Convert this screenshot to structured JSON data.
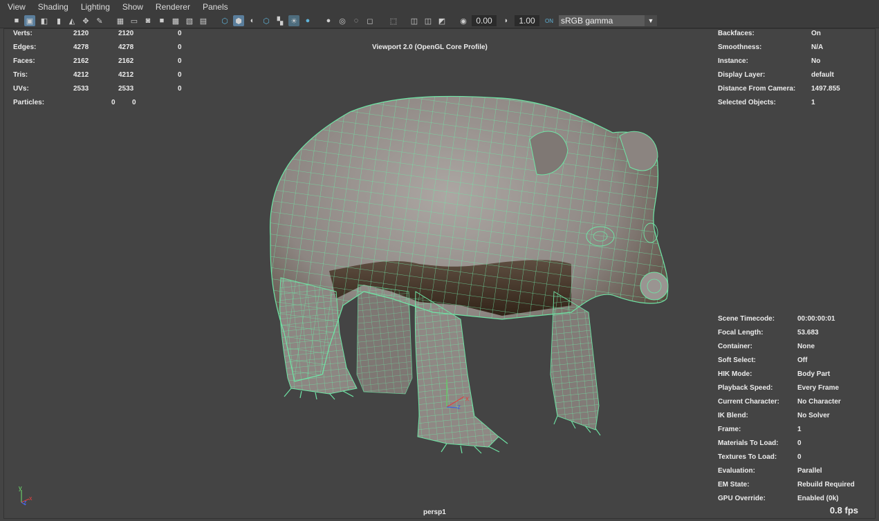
{
  "menu": [
    "View",
    "Shading",
    "Lighting",
    "Show",
    "Renderer",
    "Panels"
  ],
  "toolbar": {
    "exposure": "0.00",
    "gamma": "1.00",
    "colorspace": "sRGB gamma"
  },
  "poly_count": {
    "rows": [
      {
        "label": "Verts:",
        "c1": "2120",
        "c2": "2120",
        "c3": "0"
      },
      {
        "label": "Edges:",
        "c1": "4278",
        "c2": "4278",
        "c3": "0"
      },
      {
        "label": "Faces:",
        "c1": "2162",
        "c2": "2162",
        "c3": "0"
      },
      {
        "label": "Tris:",
        "c1": "4212",
        "c2": "4212",
        "c3": "0"
      },
      {
        "label": "UVs:",
        "c1": "2533",
        "c2": "2533",
        "c3": "0"
      }
    ],
    "particles": {
      "label": "Particles:",
      "v1": "0",
      "v2": "0"
    }
  },
  "renderer_label": "Viewport 2.0 (OpenGL Core Profile)",
  "object_details": [
    {
      "label": "Backfaces:",
      "value": "On"
    },
    {
      "label": "Smoothness:",
      "value": "N/A"
    },
    {
      "label": "Instance:",
      "value": "No"
    },
    {
      "label": "Display Layer:",
      "value": "default"
    },
    {
      "label": "Distance From Camera:",
      "value": "1497.855"
    },
    {
      "label": "Selected Objects:",
      "value": "1"
    }
  ],
  "scene_details": [
    {
      "label": "Scene Timecode:",
      "value": "00:00:00:01"
    },
    {
      "label": "Focal Length:",
      "value": "53.683"
    },
    {
      "label": "Container:",
      "value": "None"
    },
    {
      "label": "Soft Select:",
      "value": "Off"
    },
    {
      "label": "HIK Mode:",
      "value": "Body Part"
    },
    {
      "label": "Playback Speed:",
      "value": "Every Frame"
    },
    {
      "label": "Current Character:",
      "value": "No Character"
    },
    {
      "label": "IK Blend:",
      "value": "No Solver"
    },
    {
      "label": "Frame:",
      "value": "1"
    },
    {
      "label": "Materials To Load:",
      "value": "0"
    },
    {
      "label": "Textures To Load:",
      "value": "0"
    },
    {
      "label": "Evaluation:",
      "value": "Parallel"
    },
    {
      "label": "EM State:",
      "value": "Rebuild Required"
    },
    {
      "label": "GPU Override:",
      "value": "Enabled (0k)"
    }
  ],
  "camera_name": "persp1",
  "fps": "0.8 fps",
  "axes": {
    "x": "x",
    "y": "y",
    "z": "z"
  },
  "colors": {
    "wireframe": "#6fe6a6",
    "mesh": "#9b9592",
    "shadow": "#3a2a1e",
    "viewport_bg": "#444444"
  }
}
